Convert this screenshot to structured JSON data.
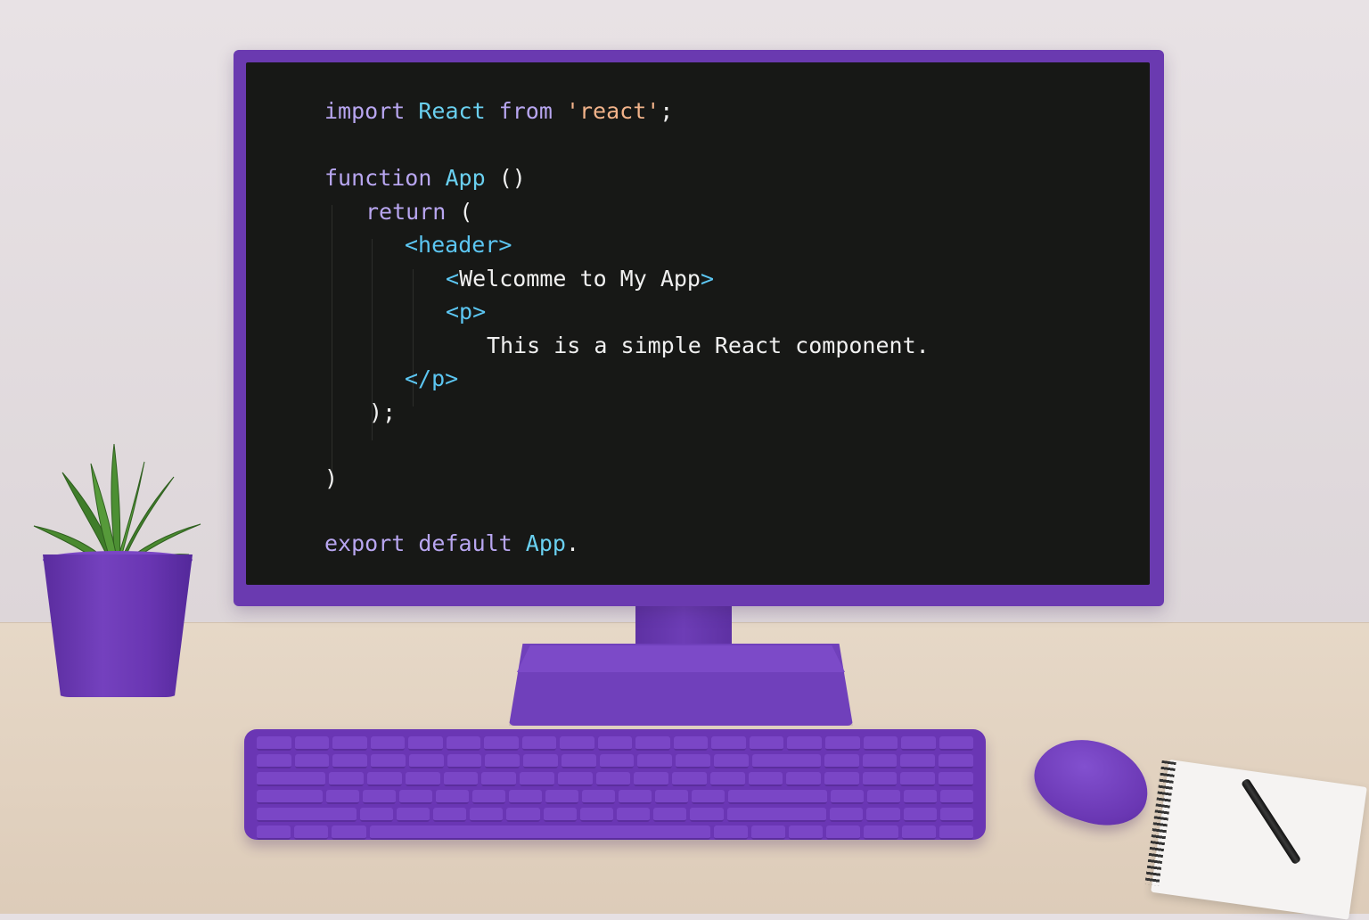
{
  "code_editor": {
    "lines": [
      {
        "tokens": [
          {
            "t": "import ",
            "c": "kw"
          },
          {
            "t": "React ",
            "c": "id"
          },
          {
            "t": "from ",
            "c": "kw"
          },
          {
            "t": "'react'",
            "c": "str"
          },
          {
            "t": ";",
            "c": "txt"
          }
        ]
      },
      {
        "tokens": []
      },
      {
        "tokens": [
          {
            "t": "function ",
            "c": "kw"
          },
          {
            "t": "App ",
            "c": "id"
          },
          {
            "t": "()",
            "c": "txt"
          }
        ]
      },
      {
        "tokens": [
          {
            "t": "return ",
            "c": "kw"
          },
          {
            "t": "(",
            "c": "txt"
          }
        ]
      },
      {
        "tokens": [
          {
            "t": "<header>",
            "c": "tag"
          }
        ]
      },
      {
        "tokens": [
          {
            "t": "<",
            "c": "tag"
          },
          {
            "t": "Welcomme to My App",
            "c": "txt"
          },
          {
            "t": ">",
            "c": "tag"
          }
        ]
      },
      {
        "tokens": [
          {
            "t": "<p>",
            "c": "tag"
          }
        ]
      },
      {
        "tokens": [
          {
            "t": "This is a simple React component.",
            "c": "txt"
          }
        ]
      },
      {
        "tokens": [
          {
            "t": "</p>",
            "c": "tag"
          }
        ]
      },
      {
        "tokens": [
          {
            "t": ");",
            "c": "txt"
          }
        ]
      },
      {
        "tokens": []
      },
      {
        "tokens": [
          {
            "t": ")",
            "c": "txt"
          }
        ]
      },
      {
        "tokens": []
      },
      {
        "tokens": [
          {
            "t": "export ",
            "c": "kw"
          },
          {
            "t": "default ",
            "c": "kw"
          },
          {
            "t": "App",
            "c": "id"
          },
          {
            "t": ".",
            "c": "txt"
          }
        ]
      }
    ]
  },
  "colors": {
    "keyword": "#b8a6f0",
    "identifier": "#6ad0f0",
    "string": "#f2b38a",
    "tag": "#5cc6f2",
    "text": "#f0f0f0",
    "screen_background": "#171816",
    "accent_purple": "#6a3ab0"
  },
  "objects": [
    "monitor",
    "keyboard",
    "mouse",
    "notebook",
    "pen",
    "potted-plant"
  ]
}
